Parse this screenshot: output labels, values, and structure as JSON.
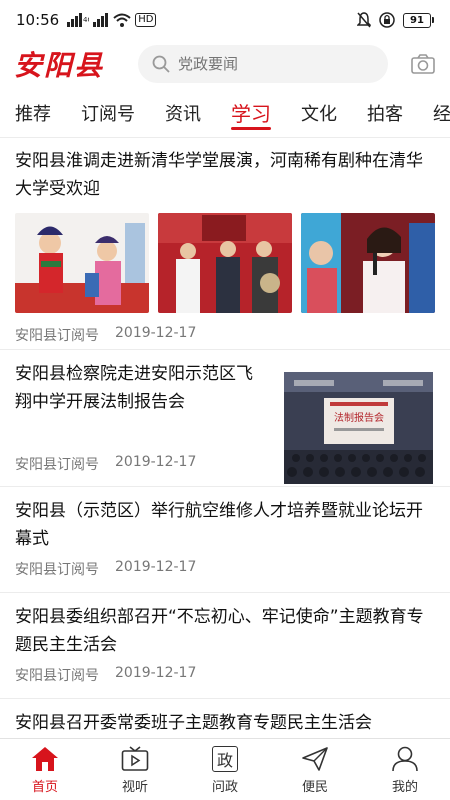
{
  "status_bar": {
    "time": "10:56",
    "network_label": "HD",
    "battery": "91",
    "icons": [
      "signal-icon",
      "wifi-icon",
      "hd-icon",
      "mute-icon",
      "vpn-icon",
      "battery-icon"
    ]
  },
  "header": {
    "logo": "安阳县",
    "search_placeholder": "党政要闻",
    "icons": [
      "search-icon",
      "camera-icon"
    ]
  },
  "tabs": [
    {
      "label": "推荐"
    },
    {
      "label": "订阅号"
    },
    {
      "label": "资讯"
    },
    {
      "label": "学习",
      "active": true
    },
    {
      "label": "文化"
    },
    {
      "label": "拍客"
    },
    {
      "label": "经济"
    }
  ],
  "feed": [
    {
      "title": "安阳县淮调走进新清华学堂展演，河南稀有剧种在清华大学受欢迎",
      "source": "安阳县订阅号",
      "date": "2019-12-17",
      "images": [
        "opera-performance-photo",
        "award-ceremony-photo",
        "singer-performance-photo"
      ]
    },
    {
      "title": "安阳县检察院走进安阳示范区飞翔中学开展法制报告会",
      "source": "安阳县订阅号",
      "date": "2019-12-17",
      "image": "lecture-hall-photo",
      "image_screen_text": "法制报告会"
    },
    {
      "title": "安阳县（示范区）举行航空维修人才培养暨就业论坛开幕式",
      "source": "安阳县订阅号",
      "date": "2019-12-17"
    },
    {
      "title": "安阳县委组织部召开“不忘初心、牢记使命”主题教育专题民主生活会",
      "source": "安阳县订阅号",
      "date": "2019-12-17"
    },
    {
      "title": "安阳县召开委常委班子主题教育专题民主生活会"
    }
  ],
  "bottom_nav": [
    {
      "label": "首页",
      "icon": "home-icon",
      "active": true
    },
    {
      "label": "视听",
      "icon": "tv-icon"
    },
    {
      "label": "问政",
      "icon": "zheng-icon",
      "glyph": "政"
    },
    {
      "label": "便民",
      "icon": "send-icon"
    },
    {
      "label": "我的",
      "icon": "profile-icon"
    }
  ],
  "colors": {
    "accent": "#d7141c",
    "text": "#111111",
    "meta": "#777777",
    "divider": "#ececec"
  }
}
